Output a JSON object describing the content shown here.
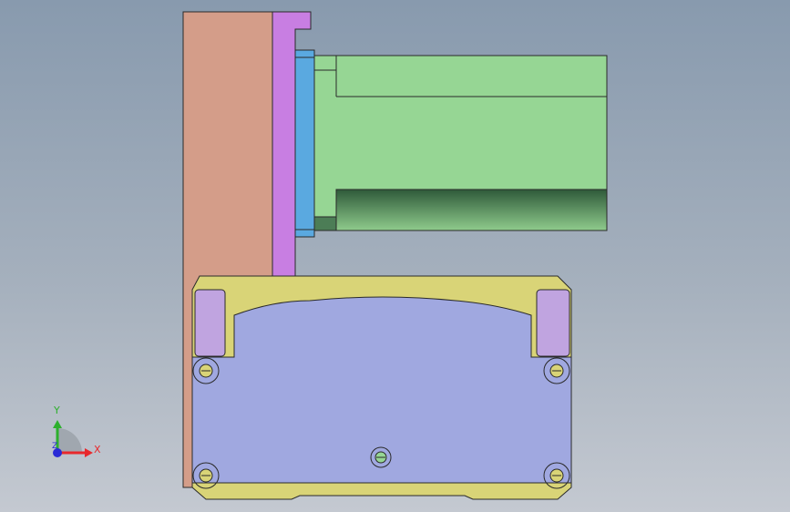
{
  "triad": {
    "x_label": "X",
    "y_label": "Y",
    "z_label": "Z",
    "x_color": "#e8282c",
    "y_color": "#2db02d",
    "z_color": "#2a2ad6"
  },
  "colors": {
    "background_top": "#889aae",
    "background_bottom": "#c4c9d1",
    "base_plate": "#d49d89",
    "vertical_bracket": "#c87ee2",
    "adapter_ring": "#5aa9e0",
    "motor_body": "#96d694",
    "motor_dark": "#3e6d48",
    "gearbox_frame": "#d9d477",
    "gearbox_cover": "#a0a8e0",
    "corner_block": "#c0a4e0"
  }
}
